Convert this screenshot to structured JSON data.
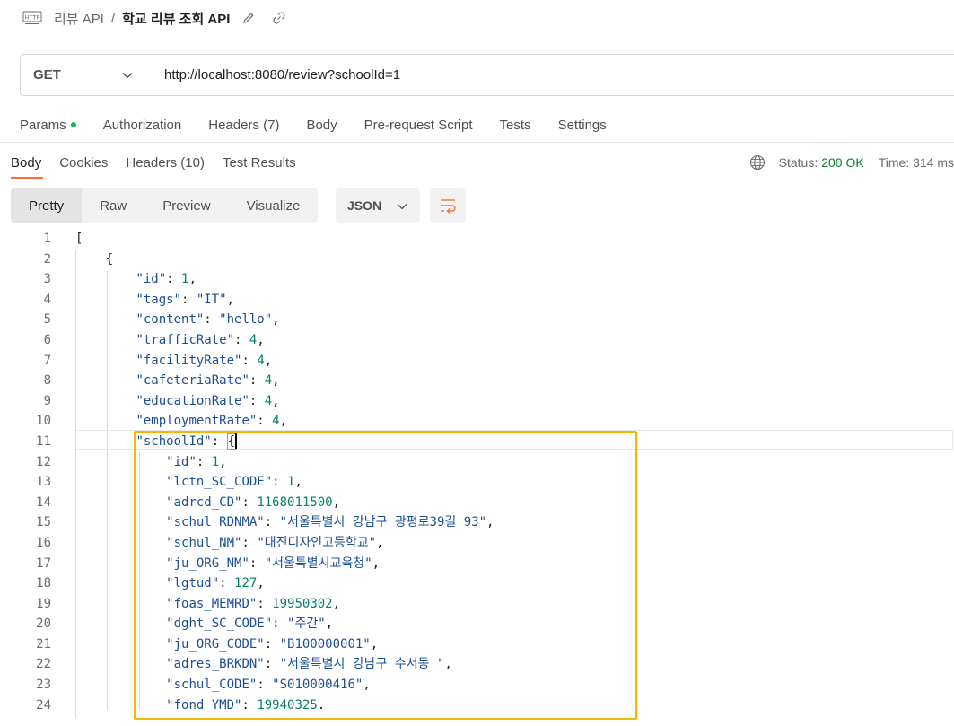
{
  "breadcrumb": {
    "icon": "http-icon",
    "parent": "리뷰 API",
    "separator": "/",
    "current": "학교 리뷰 조회 API"
  },
  "request": {
    "method": "GET",
    "url": "http://localhost:8080/review?schoolId=1"
  },
  "request_tabs": [
    {
      "label": "Params",
      "has_dot": true
    },
    {
      "label": "Authorization"
    },
    {
      "label": "Headers (7)"
    },
    {
      "label": "Body"
    },
    {
      "label": "Pre-request Script"
    },
    {
      "label": "Tests"
    },
    {
      "label": "Settings"
    }
  ],
  "response_tabs": [
    {
      "label": "Body",
      "active": true
    },
    {
      "label": "Cookies"
    },
    {
      "label": "Headers (10)"
    },
    {
      "label": "Test Results"
    }
  ],
  "response_meta": {
    "status_label": "Status:",
    "status_value": "200 OK",
    "time_label": "Time: 314 ms"
  },
  "views": [
    "Pretty",
    "Raw",
    "Preview",
    "Visualize"
  ],
  "format": "JSON",
  "colors": {
    "accent": "#ff6c37",
    "highlight_box": "#f7b600",
    "status_ok": "#0a7d2c"
  },
  "code_lines": [
    {
      "n": "1",
      "text": "["
    },
    {
      "n": "2",
      "text": "    {"
    },
    {
      "n": "3",
      "text": "        \"id\": 1,"
    },
    {
      "n": "4",
      "text": "        \"tags\": \"IT\","
    },
    {
      "n": "5",
      "text": "        \"content\": \"hello\","
    },
    {
      "n": "6",
      "text": "        \"trafficRate\": 4,"
    },
    {
      "n": "7",
      "text": "        \"facilityRate\": 4,"
    },
    {
      "n": "8",
      "text": "        \"cafeteriaRate\": 4,"
    },
    {
      "n": "9",
      "text": "        \"educationRate\": 4,"
    },
    {
      "n": "10",
      "text": "        \"employmentRate\": 4,"
    },
    {
      "n": "11",
      "text": "        \"schoolId\": {"
    },
    {
      "n": "12",
      "text": "            \"id\": 1,"
    },
    {
      "n": "13",
      "text": "            \"lctn_SC_CODE\": 1,"
    },
    {
      "n": "14",
      "text": "            \"adrcd_CD\": 1168011500,"
    },
    {
      "n": "15",
      "text": "            \"schul_RDNMA\": \"서울특별시 강남구 광평로39길 93\","
    },
    {
      "n": "16",
      "text": "            \"schul_NM\": \"대진디자인고등학교\","
    },
    {
      "n": "17",
      "text": "            \"ju_ORG_NM\": \"서울특별시교육청\","
    },
    {
      "n": "18",
      "text": "            \"lgtud\": 127,"
    },
    {
      "n": "19",
      "text": "            \"foas_MEMRD\": 19950302,"
    },
    {
      "n": "20",
      "text": "            \"dght_SC_CODE\": \"주간\","
    },
    {
      "n": "21",
      "text": "            \"ju_ORG_CODE\": \"B100000001\","
    },
    {
      "n": "22",
      "text": "            \"adres_BRKDN\": \"서울특별시 강남구 수서동 \","
    },
    {
      "n": "23",
      "text": "            \"schul_CODE\": \"S010000416\","
    },
    {
      "n": "24",
      "text": "            \"fond YMD\": 19940325."
    }
  ]
}
